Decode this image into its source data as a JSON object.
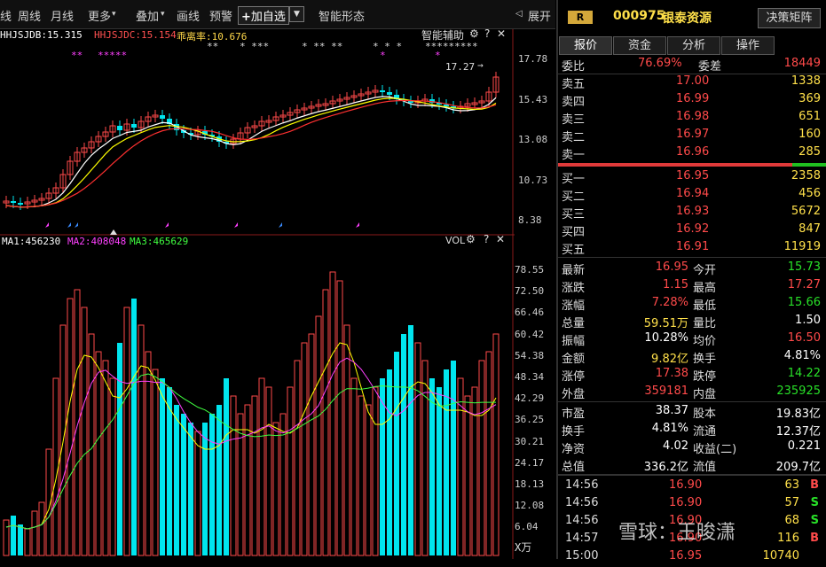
{
  "toolbar": {
    "items": [
      "线",
      "周线",
      "月线",
      "更多",
      "叠加",
      "画线",
      "预警"
    ],
    "more_arrow": "▾",
    "overlay_arrow": "▾",
    "add_favorite": "加自选",
    "add_icon": "+",
    "dropdown_icon": "▼",
    "pattern": "智能形态",
    "expand": "展开",
    "expand_icon": "◁"
  },
  "indicators_top": {
    "jdb": "HHJSJDB:15.315",
    "jdc": "HHJSJDC:15.154",
    "ratio": "乖离率:10.676",
    "assist": "智能辅助",
    "gear_icon": "gear-icon",
    "help": "?",
    "close": "✕"
  },
  "stars": {
    "white_1": "**",
    "white_2": "* ***",
    "white_3": "* ** **",
    "white_4": "* * *",
    "white_5": "* * *",
    "white_6": "*********",
    "pink_1": "**",
    "pink_2": "*****",
    "pink_3": "*",
    "pink_4": "*"
  },
  "price_axis": [
    "17.78",
    "15.43",
    "13.08",
    "10.73",
    "8.38"
  ],
  "current_price_label": "17.27",
  "vol_indicators": {
    "ma1": "MA1:456230",
    "ma2": "MA2:408048",
    "ma3": "MA3:465629",
    "vol": "VOL",
    "help": "?",
    "close": "✕"
  },
  "vol_axis": [
    "78.55",
    "72.50",
    "66.46",
    "60.42",
    "54.38",
    "48.34",
    "42.29",
    "36.25",
    "30.21",
    "24.17",
    "18.13",
    "12.08",
    "6.04"
  ],
  "vol_unit": "X万",
  "colors": {
    "up": "#ff4a4a",
    "down": "#00e5ee",
    "ma_white": "#ffffff",
    "ma_yellow": "#ffff00",
    "ma_magenta": "#ff40ff",
    "ma_green": "#40ff40",
    "red_line": "#ff3030"
  },
  "stock": {
    "badge": "R",
    "code": "000975",
    "name": "银泰资源",
    "decision_button": "决策矩阵"
  },
  "tabs": [
    "报价",
    "资金",
    "分析",
    "操作"
  ],
  "weibi": {
    "label": "委比",
    "value": "76.69%",
    "diff_label": "委差",
    "diff": "18449"
  },
  "asks": [
    {
      "label": "卖五",
      "price": "17.00",
      "vol": "1338"
    },
    {
      "label": "卖四",
      "price": "16.99",
      "vol": "369"
    },
    {
      "label": "卖三",
      "price": "16.98",
      "vol": "651"
    },
    {
      "label": "卖二",
      "price": "16.97",
      "vol": "160"
    },
    {
      "label": "卖一",
      "price": "16.96",
      "vol": "285"
    }
  ],
  "bids": [
    {
      "label": "买一",
      "price": "16.95",
      "vol": "2358"
    },
    {
      "label": "买二",
      "price": "16.94",
      "vol": "456"
    },
    {
      "label": "买三",
      "price": "16.93",
      "vol": "5672"
    },
    {
      "label": "买四",
      "price": "16.92",
      "vol": "847"
    },
    {
      "label": "买五",
      "price": "16.91",
      "vol": "11919"
    }
  ],
  "stats": [
    {
      "l1": "最新",
      "v1": "16.95",
      "c1": "red",
      "l2": "今开",
      "v2": "15.73",
      "c2": "green"
    },
    {
      "l1": "涨跌",
      "v1": "1.15",
      "c1": "red",
      "l2": "最高",
      "v2": "17.27",
      "c2": "red"
    },
    {
      "l1": "涨幅",
      "v1": "7.28%",
      "c1": "red",
      "l2": "最低",
      "v2": "15.66",
      "c2": "green"
    },
    {
      "l1": "总量",
      "v1": "59.51万",
      "c1": "yellow",
      "l2": "量比",
      "v2": "1.50",
      "c2": "white"
    },
    {
      "l1": "振幅",
      "v1": "10.28%",
      "c1": "white",
      "l2": "均价",
      "v2": "16.50",
      "c2": "red"
    },
    {
      "l1": "金额",
      "v1": "9.82亿",
      "c1": "yellow",
      "l2": "换手",
      "v2": "4.81%",
      "c2": "white"
    },
    {
      "l1": "涨停",
      "v1": "17.38",
      "c1": "red",
      "l2": "跌停",
      "v2": "14.22",
      "c2": "green"
    },
    {
      "l1": "外盘",
      "v1": "359181",
      "c1": "red",
      "l2": "内盘",
      "v2": "235925",
      "c2": "green"
    }
  ],
  "fundamentals": [
    {
      "l1": "市盈",
      "v1": "38.37",
      "l2": "股本",
      "v2": "19.83亿"
    },
    {
      "l1": "换手",
      "v1": "4.81%",
      "l2": "流通",
      "v2": "12.37亿"
    },
    {
      "l1": "净资",
      "v1": "4.02",
      "l2": "收益(二)",
      "v2": "0.221"
    },
    {
      "l1": "总值",
      "v1": "336.2亿",
      "l2": "流值",
      "v2": "209.7亿"
    }
  ],
  "trades": [
    {
      "time": "14:56",
      "price": "16.90",
      "vol": "63",
      "side": "B"
    },
    {
      "time": "14:56",
      "price": "16.90",
      "vol": "57",
      "side": "S"
    },
    {
      "time": "14:56",
      "price": "16.90",
      "vol": "68",
      "side": "S"
    },
    {
      "time": "14:57",
      "price": "16.90",
      "vol": "116",
      "side": "B"
    },
    {
      "time": "15:00",
      "price": "16.95",
      "vol": "10740",
      "side": ""
    }
  ],
  "watermark": "雪球：王晙潇"
}
